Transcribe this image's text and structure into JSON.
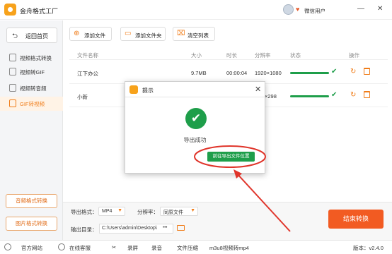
{
  "app": {
    "title": "金舟格式工厂",
    "user_name": "微信用户",
    "minimize": "—",
    "close": "✕"
  },
  "sidebar": {
    "home_label": "返回首页",
    "items": [
      {
        "label": "视频格式转换"
      },
      {
        "label": "视频转GIF"
      },
      {
        "label": "视频转音频"
      },
      {
        "label": "GIF转视频"
      }
    ],
    "active_index": 3,
    "cards": [
      {
        "label": "音频格式转换"
      },
      {
        "label": "图片格式转换"
      }
    ]
  },
  "toolbar": {
    "add_file": "添加文件",
    "add_folder": "添加文件夹",
    "clear_list": "清空列表"
  },
  "table": {
    "headers": [
      "文件名称",
      "大小",
      "时长",
      "分辨率",
      "状态",
      "操作"
    ],
    "rows": [
      {
        "name": "江下办公",
        "size": "9.7MB",
        "duration": "00:00:04",
        "resolution": "1920×1080",
        "progress": 1.0
      },
      {
        "name": "小新",
        "size": "",
        "duration": "",
        "resolution": "×298",
        "progress": 1.0
      }
    ]
  },
  "bottom": {
    "format_label": "导出格式：",
    "format_value": "MP4",
    "resolution_label": "分辨率：",
    "resolution_value": "同原文件",
    "output_label": "输出目录：",
    "output_path": "C:\\Users\\admin\\Desktop\\",
    "more": "•••",
    "convert_label": "结束转换"
  },
  "status": {
    "website": "官方网站",
    "support": "在线客服",
    "record": "录屏",
    "audio": "录音",
    "compress": "文件压缩",
    "m3u8": "m3u8视频转mp4",
    "version": "版本：v2.4.0"
  },
  "dialog": {
    "title": "提示",
    "message": "导出成功",
    "goto_label": "前往导出文件位置",
    "close": "✕"
  },
  "colors": {
    "accent": "#f07c18",
    "success": "#1e9e4a",
    "annotation": "#e0352b",
    "convert": "#f25b22"
  }
}
